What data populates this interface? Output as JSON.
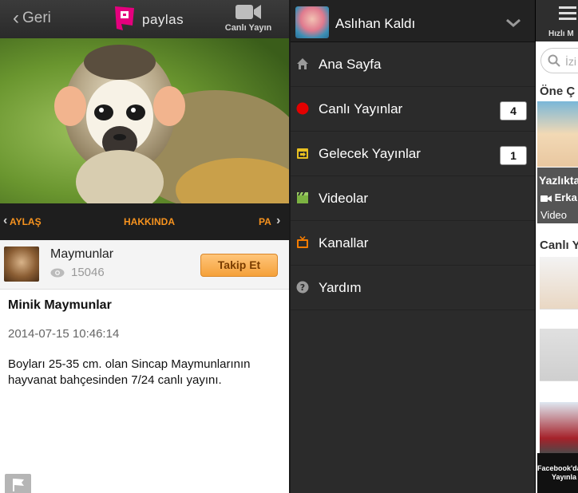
{
  "detail": {
    "back_label": "Geri",
    "logo_text": "paylas",
    "live_button_label": "Canlı Yayın",
    "tabs": {
      "prev": "AYLAŞ",
      "active": "HAKKINDA",
      "next": "PA"
    },
    "channel": {
      "name": "Maymunlar",
      "views": "15046",
      "follow_label": "Takip Et"
    },
    "stream": {
      "title": "Minik Maymunlar",
      "datetime": "2014-07-15 10:46:14",
      "description": "Boyları 25-35 cm. olan Sincap Maymunlarının hayvanat bahçesinden 7/24 canlı yayını."
    }
  },
  "menu": {
    "user_name": "Aslıhan Kaldı",
    "items": [
      {
        "label": "Ana Sayfa",
        "icon": "home-icon",
        "badge": null
      },
      {
        "label": "Canlı Yayınlar",
        "icon": "live-dot-icon",
        "badge": "4"
      },
      {
        "label": "Gelecek Yayınlar",
        "icon": "calendar-icon",
        "badge": "1"
      },
      {
        "label": "Videolar",
        "icon": "clapperboard-icon",
        "badge": null
      },
      {
        "label": "Kanallar",
        "icon": "tv-icon",
        "badge": null
      },
      {
        "label": "Yardım",
        "icon": "help-icon",
        "badge": null
      }
    ]
  },
  "peek": {
    "menu_label": "Hızlı M",
    "search_placeholder": "İzi",
    "section_featured": "Öne Ç",
    "card_title": "Yazlıkta",
    "card_author": "Erka",
    "card_type": "Video",
    "section_live": "Canlı Y",
    "banner_line1": "Facebook'da",
    "banner_line2": "Yayınla"
  },
  "colors": {
    "accent": "#f7931e",
    "brand_pink": "#e5007e",
    "live_red": "#e30000",
    "menu_bg": "#2b2b2b"
  }
}
